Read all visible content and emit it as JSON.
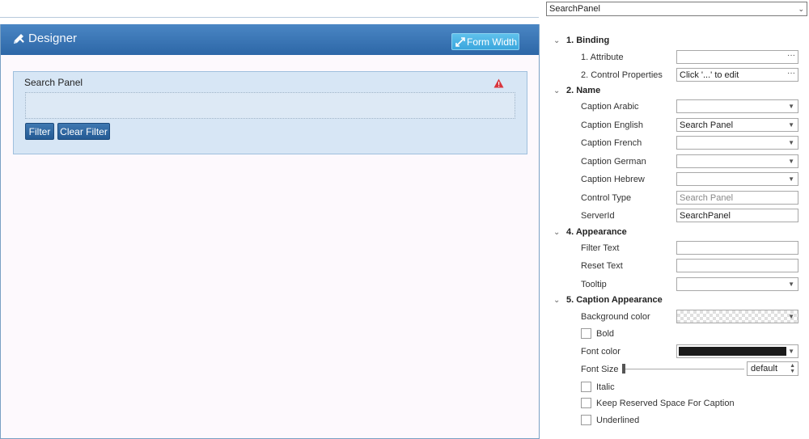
{
  "designer": {
    "title": "Designer",
    "form_width_label": "Form Width",
    "search_panel": {
      "caption": "Search Panel",
      "filter_label": "Filter",
      "clear_filter_label": "Clear Filter"
    }
  },
  "properties": {
    "selector_value": "SearchPanel",
    "sections": {
      "binding": "1. Binding",
      "name": "2. Name",
      "appearance": "4. Appearance",
      "caption_appearance": "5. Caption Appearance"
    },
    "binding": {
      "attribute_label": "1. Attribute",
      "attribute_value": "",
      "control_properties_label": "2. Control Properties",
      "control_properties_value": "Click '...' to edit"
    },
    "name": {
      "caption_arabic_label": "Caption Arabic",
      "caption_arabic_value": "",
      "caption_english_label": "Caption English",
      "caption_english_value": "Search Panel",
      "caption_french_label": "Caption French",
      "caption_french_value": "",
      "caption_german_label": "Caption German",
      "caption_german_value": "",
      "caption_hebrew_label": "Caption Hebrew",
      "caption_hebrew_value": "",
      "control_type_label": "Control Type",
      "control_type_value": "Search Panel",
      "server_id_label": "ServerId",
      "server_id_value": "SearchPanel"
    },
    "appearance": {
      "filter_text_label": "Filter Text",
      "filter_text_value": "",
      "reset_text_label": "Reset Text",
      "reset_text_value": "",
      "tooltip_label": "Tooltip",
      "tooltip_value": ""
    },
    "caption_appearance": {
      "background_color_label": "Background color",
      "bold_label": "Bold",
      "font_color_label": "Font color",
      "font_color": "#1a1a1a",
      "font_size_label": "Font Size",
      "font_size_value": "default",
      "italic_label": "Italic",
      "keep_reserved_label": "Keep Reserved Space For Caption",
      "underlined_label": "Underlined"
    }
  },
  "colors": {
    "header_blue": "#2d67a7",
    "accent_cyan": "#3aa6dd",
    "panel_bg": "#d7e6f5",
    "warning_red": "#d9363e"
  }
}
